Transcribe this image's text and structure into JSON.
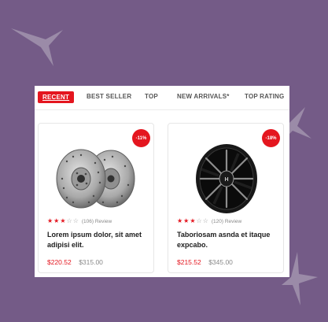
{
  "tabs": [
    {
      "label": "RECENT",
      "active": true
    },
    {
      "label": "BEST SELLER",
      "active": false
    },
    {
      "label": "TOP",
      "active": false
    },
    {
      "label": "NEW ARRIVALS*",
      "active": false
    },
    {
      "label": "TOP RATING",
      "active": false
    }
  ],
  "products": [
    {
      "image": "brake-rotors",
      "discount": "-11%",
      "rating": 3,
      "rating_max": 5,
      "review_text": "(106) Review",
      "title": "Lorem ipsum dolor, sit amet adipisi elit.",
      "price": "$220.52",
      "old_price": "$315.00"
    },
    {
      "image": "black-alloy-wheel",
      "discount": "-18%",
      "rating": 3,
      "rating_max": 5,
      "review_text": "(120) Review",
      "title": "Taboriosam asnda et itaque expcabo.",
      "price": "$215.52",
      "old_price": "$345.00"
    }
  ],
  "colors": {
    "background": "#745b87",
    "accent": "#e4161f",
    "panel": "#ffffff"
  }
}
